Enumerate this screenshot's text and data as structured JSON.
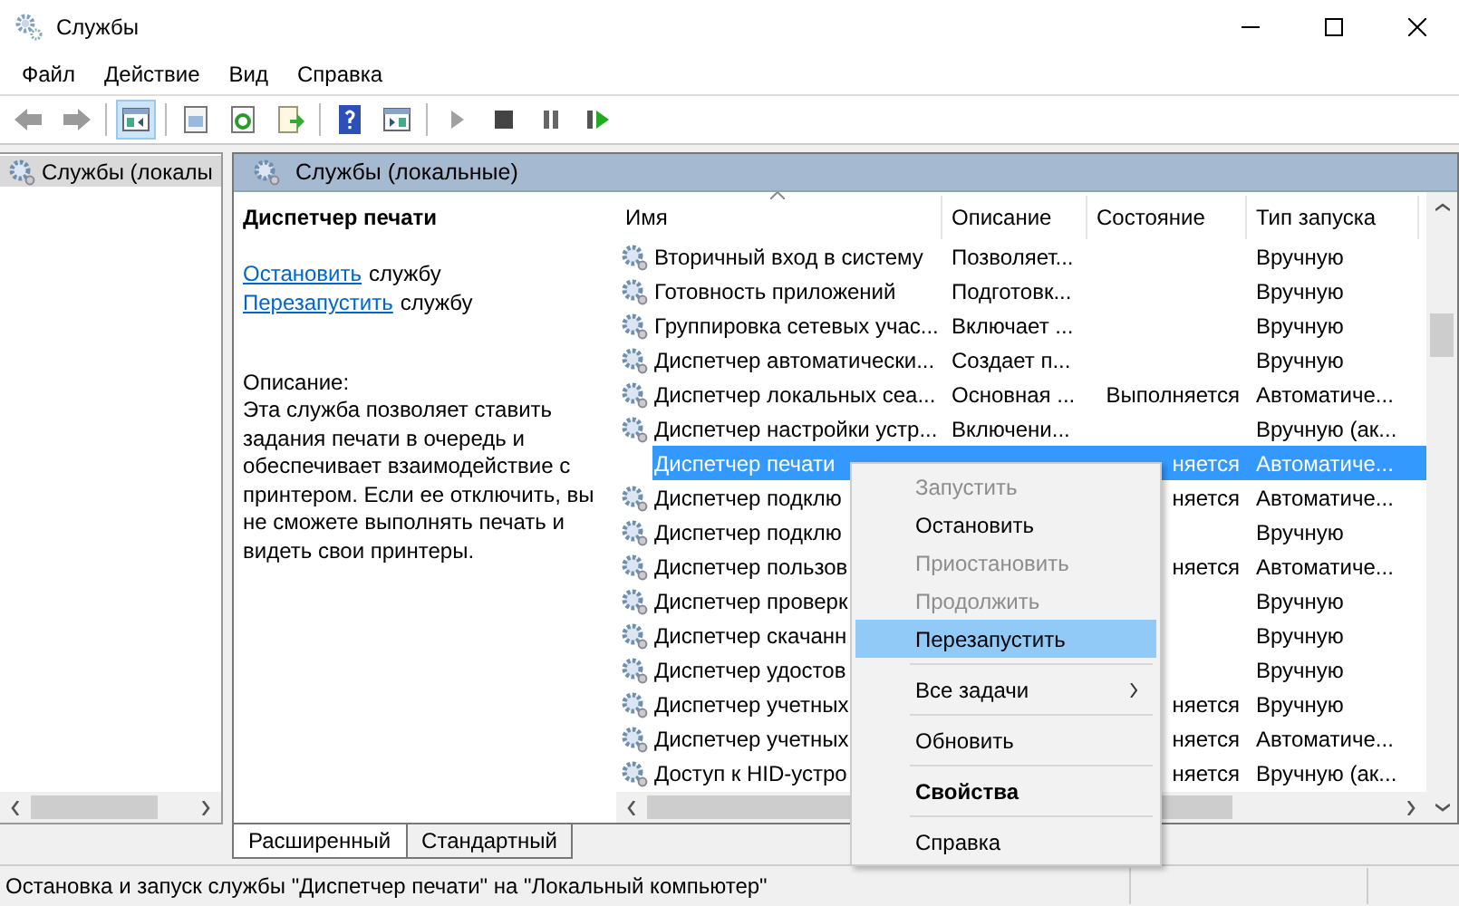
{
  "window": {
    "title": "Службы"
  },
  "menu_bar": [
    "Файл",
    "Действие",
    "Вид",
    "Справка"
  ],
  "toolbar": [
    {
      "kind": "back",
      "disabled": true
    },
    {
      "kind": "forward",
      "disabled": true
    },
    {
      "kind": "sep"
    },
    {
      "kind": "tree",
      "selected": true
    },
    {
      "kind": "sep"
    },
    {
      "kind": "properties",
      "selected": false
    },
    {
      "kind": "refresh",
      "selected": false
    },
    {
      "kind": "export",
      "selected": false
    },
    {
      "kind": "sep"
    },
    {
      "kind": "help",
      "selected": false
    },
    {
      "kind": "view",
      "selected": false
    },
    {
      "kind": "sep"
    },
    {
      "kind": "play",
      "disabled": true
    },
    {
      "kind": "stop",
      "disabled": false
    },
    {
      "kind": "pause",
      "disabled": false
    },
    {
      "kind": "resume",
      "disabled": false
    }
  ],
  "tree": {
    "items": [
      {
        "label": "Службы (локалы",
        "selected": true
      }
    ]
  },
  "header": {
    "title": "Службы (локальные)"
  },
  "details": {
    "service": "Диспетчер печати",
    "actions": [
      {
        "link": "Остановить",
        "text": "службу"
      },
      {
        "link": "Перезапустить",
        "text": "службу"
      }
    ],
    "description_label": "Описание:",
    "description": "Эта служба позволяет ставить задания печати в очередь и обеспечивает взаимодействие с принтером. Если ее отключить, вы не сможете выполнять печать и видеть свои принтеры."
  },
  "list": {
    "columns": [
      "Имя",
      "Описание",
      "Состояние",
      "Тип запуска"
    ],
    "rows": [
      {
        "name": "Вторичный вход в систему",
        "description": "Позволяет...",
        "state": "",
        "startup": "Вручную",
        "selected": false
      },
      {
        "name": "Готовность приложений",
        "description": "Подготовк...",
        "state": "",
        "startup": "Вручную",
        "selected": false
      },
      {
        "name": "Группировка сетевых учас...",
        "description": "Включает ...",
        "state": "",
        "startup": "Вручную",
        "selected": false
      },
      {
        "name": "Диспетчер автоматически...",
        "description": "Создает п...",
        "state": "",
        "startup": "Вручную",
        "selected": false
      },
      {
        "name": "Диспетчер локальных сеа...",
        "description": "Основная ...",
        "state": "Выполняется",
        "startup": "Автоматиче...",
        "selected": false
      },
      {
        "name": "Диспетчер настройки устр...",
        "description": "Включени...",
        "state": "",
        "startup": "Вручную (ак...",
        "selected": false
      },
      {
        "name": "Диспетчер печати",
        "description": "",
        "state": "няется",
        "startup": "Автоматиче...",
        "selected": true
      },
      {
        "name": "Диспетчер подклю",
        "description": "",
        "state": "няется",
        "startup": "Автоматиче...",
        "selected": false
      },
      {
        "name": "Диспетчер подклю",
        "description": "",
        "state": "",
        "startup": "Вручную",
        "selected": false
      },
      {
        "name": "Диспетчер пользов",
        "description": "",
        "state": "няется",
        "startup": "Автоматиче...",
        "selected": false
      },
      {
        "name": "Диспетчер проверк",
        "description": "",
        "state": "",
        "startup": "Вручную",
        "selected": false
      },
      {
        "name": "Диспетчер скачанн",
        "description": "",
        "state": "",
        "startup": "Вручную",
        "selected": false
      },
      {
        "name": "Диспетчер удостов",
        "description": "",
        "state": "",
        "startup": "Вручную",
        "selected": false
      },
      {
        "name": "Диспетчер учетных",
        "description": "",
        "state": "няется",
        "startup": "Вручную",
        "selected": false
      },
      {
        "name": "Диспетчер учетных",
        "description": "",
        "state": "няется",
        "startup": "Автоматиче...",
        "selected": false
      },
      {
        "name": "Доступ к HID-устро",
        "description": "",
        "state": "няется",
        "startup": "Вручную (ак...",
        "selected": false
      }
    ]
  },
  "context_menu": [
    {
      "kind": "item",
      "label": "Запустить",
      "disabled": true,
      "selected": false
    },
    {
      "kind": "item",
      "label": "Остановить",
      "disabled": false,
      "selected": false
    },
    {
      "kind": "item",
      "label": "Приостановить",
      "disabled": true,
      "selected": false
    },
    {
      "kind": "item",
      "label": "Продолжить",
      "disabled": true,
      "selected": false
    },
    {
      "kind": "item",
      "label": "Перезапустить",
      "disabled": false,
      "selected": true
    },
    {
      "kind": "separator"
    },
    {
      "kind": "submenu",
      "label": "Все задачи",
      "disabled": false,
      "selected": false
    },
    {
      "kind": "separator"
    },
    {
      "kind": "item",
      "label": "Обновить",
      "disabled": false,
      "selected": false
    },
    {
      "kind": "separator"
    },
    {
      "kind": "default",
      "label": "Свойства",
      "disabled": false,
      "selected": false
    },
    {
      "kind": "separator"
    },
    {
      "kind": "item",
      "label": "Справка",
      "disabled": false,
      "selected": false
    }
  ],
  "tabs": [
    {
      "label": "Расширенный",
      "selected": true
    },
    {
      "label": "Стандартный",
      "selected": false
    }
  ],
  "status_bar": "Остановка и запуск службы \"Диспетчер печати\" на \"Локальный компьютер\""
}
